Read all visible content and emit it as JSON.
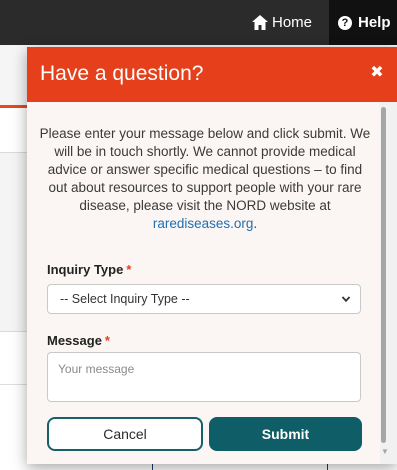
{
  "nav": {
    "home_label": "Home",
    "help_label": "Help",
    "help_glyph": "?"
  },
  "modal": {
    "title": "Have a question?",
    "close_glyph": "✖",
    "intro_text": "Please enter your message below and click submit. We will be in touch shortly. We cannot provide medical advice or answer specific medical questions – to find out about resources to support people with your rare disease, please visit the NORD website at ",
    "intro_link": "rarediseases.org",
    "intro_end": ".",
    "inquiry_label": "Inquiry Type",
    "inquiry_selected": "-- Select Inquiry Type --",
    "message_label": "Message",
    "message_placeholder": "Your message",
    "required_mark": "*",
    "cancel_label": "Cancel",
    "submit_label": "Submit"
  },
  "colors": {
    "header_accent": "#e5401b",
    "primary_button": "#0f5d67",
    "link": "#1f6fb2",
    "topbar": "#2b2b2b"
  },
  "icons": {
    "home": "home-icon",
    "help": "help-circle-icon",
    "close": "close-icon",
    "select_arrow": "chevron-down-icon"
  }
}
